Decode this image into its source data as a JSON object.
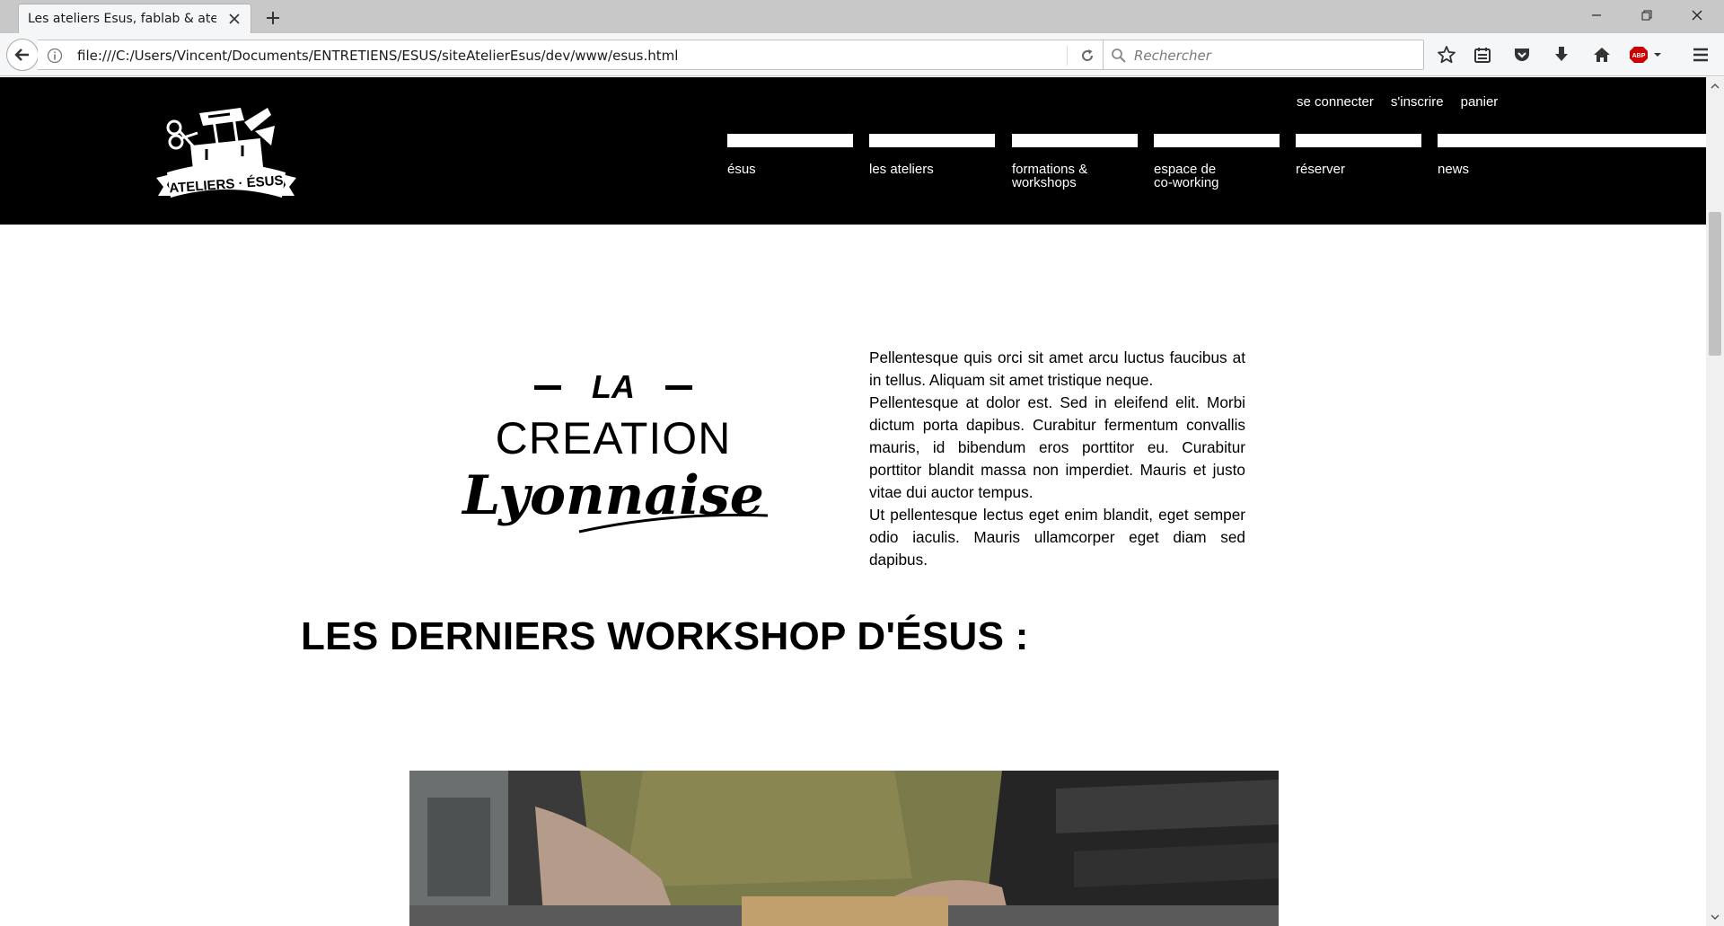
{
  "browser": {
    "tab_title": "Les ateliers Esus, fablab & atel...",
    "url": "file:///C:/Users/Vincent/Documents/ENTRETIENS/ESUS/siteAtelierEsus/dev/www/esus.html",
    "search_placeholder": "Rechercher",
    "toolbar_icons": [
      "star-icon",
      "reader-list-icon",
      "pocket-icon",
      "download-icon",
      "home-icon",
      "adblock-icon",
      "menu-icon"
    ]
  },
  "site": {
    "logo_text": "ATELIERS · ÉSUS",
    "user_links": [
      "se connecter",
      "s'inscrire",
      "panier"
    ],
    "menu": [
      {
        "label": "ésus"
      },
      {
        "label": "les ateliers"
      },
      {
        "label": "formations &\nworkshops"
      },
      {
        "label": "espace de\nco-working"
      },
      {
        "label": "réserver"
      },
      {
        "label": "news"
      }
    ]
  },
  "intro": {
    "brand_logo": {
      "line1": "LA",
      "line2": "CREATION",
      "line3": "Lyonnaise"
    },
    "paragraphs": [
      "Pellentesque quis orci sit amet arcu luctus faucibus at in tellus. Aliquam sit amet tristique neque.",
      "Pellentesque at dolor est. Sed in eleifend elit. Morbi dictum porta dapibus. Curabitur fermentum convallis mauris, id bibendum eros porttitor eu. Curabitur porttitor blandit massa non imperdiet. Mauris et justo vitae dui auctor tempus.",
      "Ut pellentesque lectus eget enim blandit, eget semper odio iaculis. Mauris ullamcorper eget diam sed dapibus."
    ]
  },
  "workshops": {
    "title": "LES DERNIERS WORKSHOP D'ÉSUS :"
  }
}
